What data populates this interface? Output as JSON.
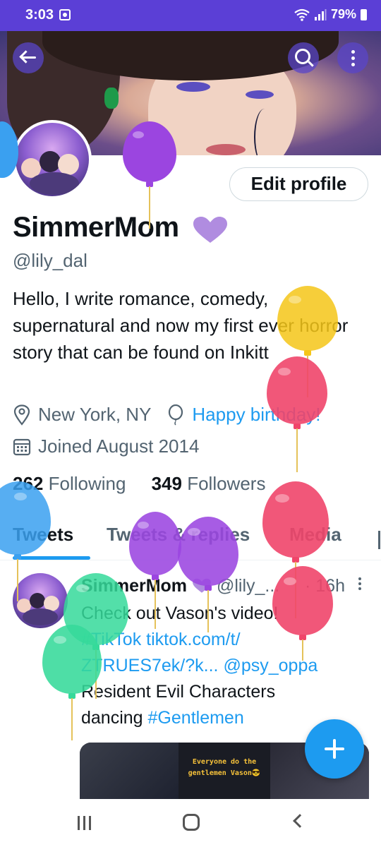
{
  "status_bar": {
    "time": "3:03",
    "battery": "79%"
  },
  "profile": {
    "edit_label": "Edit profile",
    "display_name": "SimmerMom",
    "handle": "@lily_dal",
    "bio": "Hello, I write romance, comedy, supernatural and now my first ever horror story that can be found on Inkitt",
    "location": "New York, NY",
    "birthday": "Happy birthday!",
    "joined": "Joined August 2014",
    "following_count": "262",
    "following_label": "Following",
    "followers_count": "349",
    "followers_label": "Followers"
  },
  "tabs": [
    "Tweets",
    "Tweets & replies",
    "Media"
  ],
  "tweet": {
    "name": "SimmerMom",
    "handle": "@lily_...",
    "time": "· 16h",
    "line1": "Check out Vason's video!",
    "link1": "#TikTok tiktok.com/t/",
    "link2": "ZTRUES7ek/?k...",
    "mention": "@psy_oppa",
    "line2": "Resident Evil Characters",
    "line3_prefix": "dancing ",
    "hashtag": "#Gentlemen",
    "media_caption_1": "Everyone do the",
    "media_caption_2": "gentlemen Vason😎"
  },
  "colors": {
    "accent": "#1d9bf0",
    "status_bar": "#5b3fd6",
    "heart": "#b08ce0",
    "balloon_purple": "#9b45e0",
    "balloon_red": "#f0456a",
    "balloon_yellow": "#f5c518",
    "balloon_green": "#35d99a",
    "balloon_blue": "#3aa0f0"
  }
}
